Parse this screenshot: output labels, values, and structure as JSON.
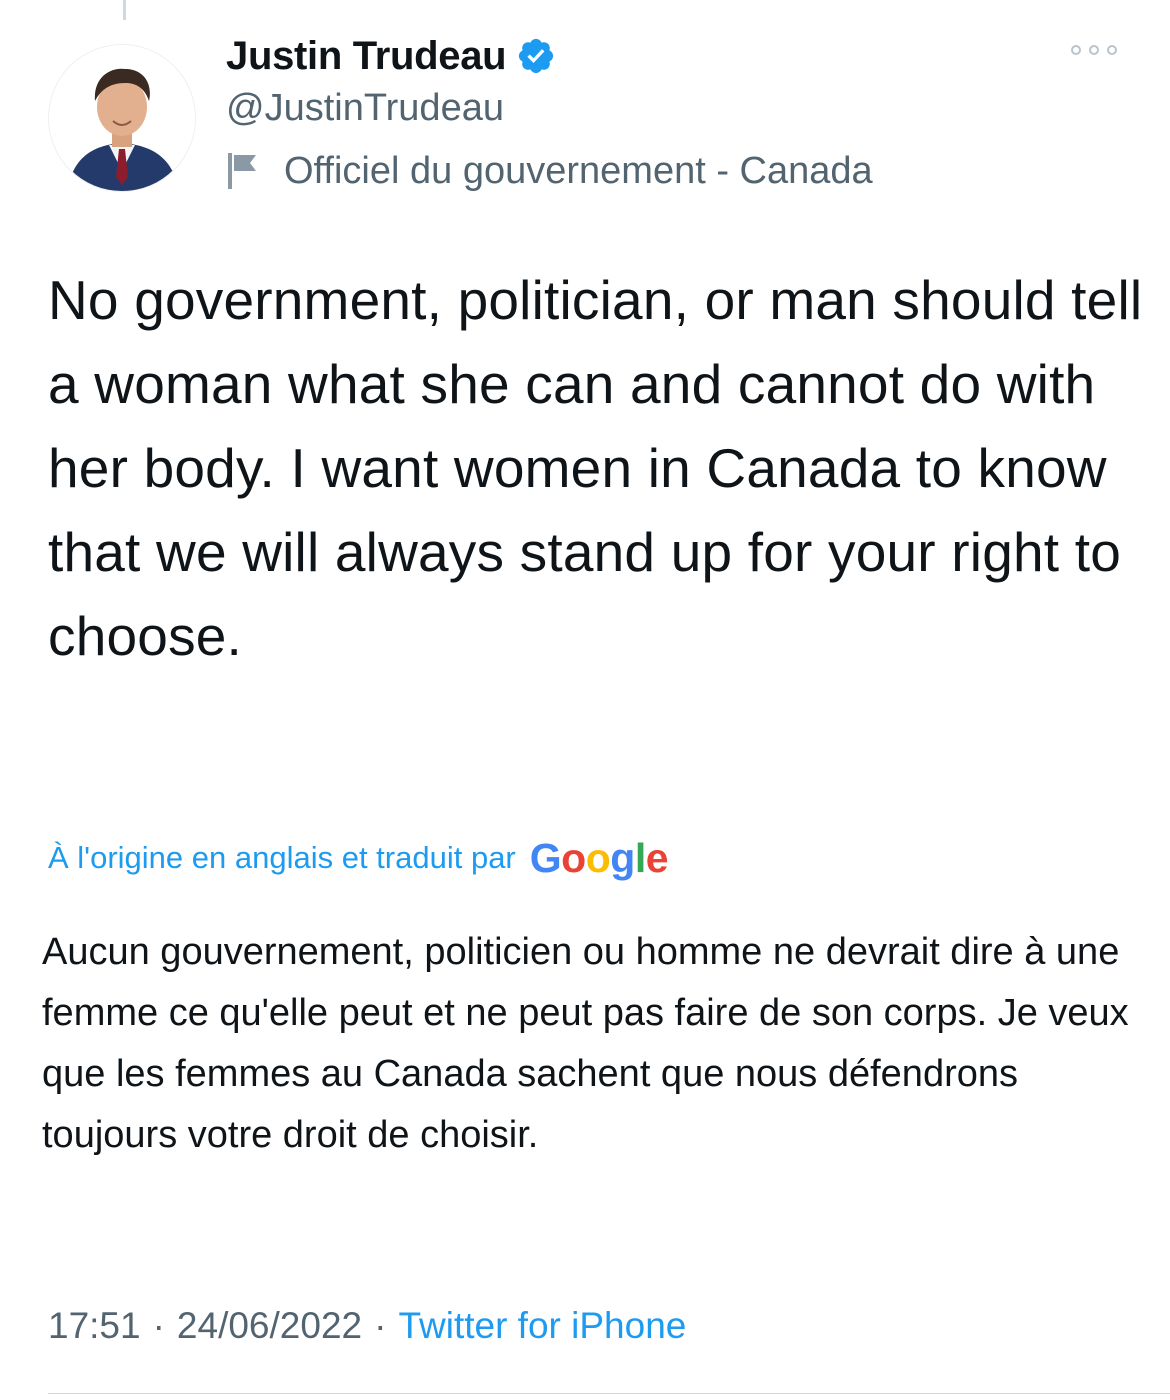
{
  "author": {
    "display_name": "Justin Trudeau",
    "handle": "@JustinTrudeau",
    "label": "Officiel du gouvernement - Canada",
    "verified": true
  },
  "tweet": {
    "text": "No government, politician, or man should tell a woman what she can and cannot do with her body. I want women in Canada to know that we will always stand up for your right to choose.",
    "translation_label": "À l'origine en anglais et traduit par",
    "translation_provider": "Google",
    "translated_text": "Aucun gouvernement, politicien ou homme ne devrait dire à une femme ce qu'elle peut et ne peut pas faire de son corps. Je veux que les femmes au Canada sachent que nous défendrons toujours votre droit de choisir."
  },
  "meta": {
    "time": "17:51",
    "separator": "·",
    "date": "24/06/2022",
    "source": "Twitter for iPhone"
  },
  "icons": {
    "verified": "verified-badge-icon",
    "flag": "flag-icon",
    "more": "more-options-icon"
  },
  "colors": {
    "accent": "#1d9bf0",
    "secondary_text": "#536471",
    "primary_text": "#0f1419"
  }
}
